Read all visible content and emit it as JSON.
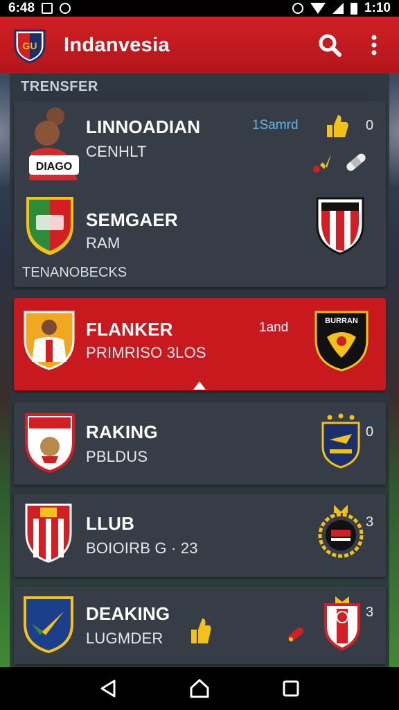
{
  "status_bar": {
    "time_left": "6:48",
    "time_right": "1:10",
    "icons": [
      "notification-box-icon",
      "lock-icon",
      "alarm-icon",
      "wifi-icon",
      "signal-icon",
      "battery-icon"
    ]
  },
  "app_bar": {
    "title": "Indanvesia",
    "actions": [
      "search-icon",
      "more-vert-icon"
    ]
  },
  "section": {
    "label": "TRENSFER"
  },
  "cards": [
    {
      "name": "LINNOADIAN",
      "subtitle": "CENHLT",
      "meta": "1Samrd",
      "count": "0",
      "icons": [
        "thumbs-up-icon",
        "hand-icon",
        "bandage-icon"
      ]
    },
    {
      "name": "SEMGAER",
      "subtitle": "RAM",
      "footer": "TENANOBECKS"
    },
    {
      "name": "FLANKER",
      "subtitle": "PRIMRISO 3LOS",
      "meta": "1and",
      "highlighted": true
    },
    {
      "name": "RAKING",
      "subtitle": "PBLDUS",
      "count": "0"
    },
    {
      "name": "LLUB",
      "subtitle": "BOIOIRB G · 23",
      "count": "3"
    },
    {
      "name": "DEAKING",
      "subtitle": "LUGMDER",
      "count": "3",
      "icons": [
        "thumbs-up-icon",
        "whistle-icon"
      ]
    }
  ],
  "player_shirt_text": "DIAGO",
  "crest_text": {
    "app_logo": "GU",
    "flanker_crest": "BURRAN"
  },
  "colors": {
    "primary_red": "#c8191e",
    "card_bg": "#373d47",
    "accent_blue": "#5eb8ea",
    "gold": "#f2c219"
  },
  "nav_bar": {
    "buttons": [
      "back-icon",
      "home-icon",
      "recents-icon"
    ]
  }
}
